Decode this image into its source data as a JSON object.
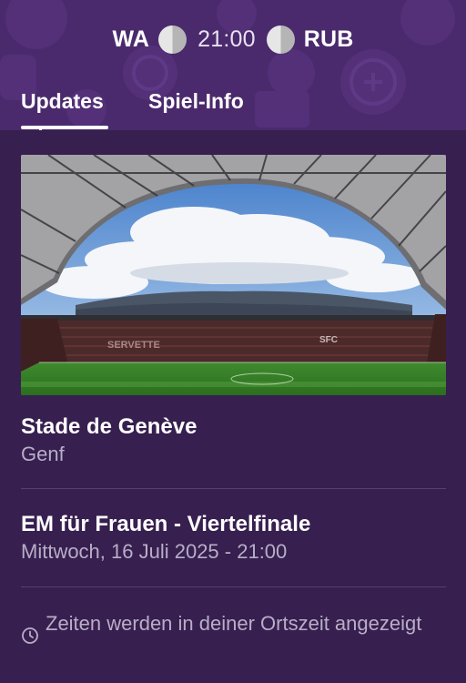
{
  "match": {
    "home_team": "WA",
    "away_team": "RUB",
    "kickoff_time": "21:00"
  },
  "tabs": [
    {
      "label": "Updates",
      "active": true
    },
    {
      "label": "Spiel-Info",
      "active": false
    }
  ],
  "venue": {
    "name": "Stade de Genève",
    "city": "Genf",
    "image_alt": "Stadium photo",
    "stand_texts": [
      "SERVETTE",
      "SFC"
    ]
  },
  "competition": {
    "name": "EM für Frauen - Viertelfinale",
    "datetime": "Mittwoch, 16 Juli 2025 - 21:00"
  },
  "timezone_note": "Zeiten werden in deiner Ortszeit angezeigt",
  "icons": {
    "home_flag": "flag-icon",
    "away_flag": "flag-icon",
    "timezone": "clock-icon"
  },
  "colors": {
    "header_bg": "#4a2a6d",
    "page_bg": "#371f4f",
    "secondary_text": "#b8aec7",
    "divider": "#56416d"
  }
}
